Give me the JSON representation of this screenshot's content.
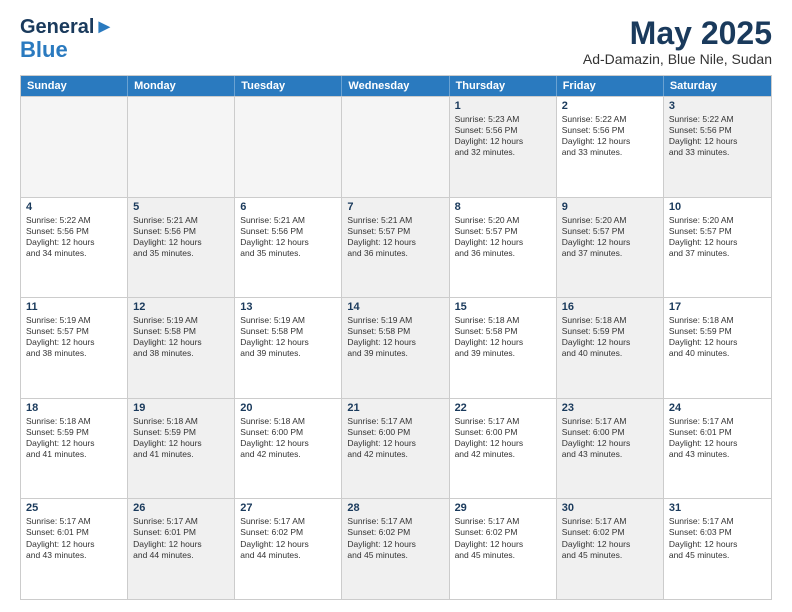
{
  "header": {
    "logo_line1": "General",
    "logo_line2": "Blue",
    "main_title": "May 2025",
    "subtitle": "Ad-Damazin, Blue Nile, Sudan"
  },
  "calendar": {
    "days_of_week": [
      "Sunday",
      "Monday",
      "Tuesday",
      "Wednesday",
      "Thursday",
      "Friday",
      "Saturday"
    ],
    "weeks": [
      [
        {
          "day": "",
          "empty": true
        },
        {
          "day": "",
          "empty": true
        },
        {
          "day": "",
          "empty": true
        },
        {
          "day": "",
          "empty": true
        },
        {
          "day": "1",
          "shaded": true,
          "lines": [
            "Sunrise: 5:23 AM",
            "Sunset: 5:56 PM",
            "Daylight: 12 hours",
            "and 32 minutes."
          ]
        },
        {
          "day": "2",
          "lines": [
            "Sunrise: 5:22 AM",
            "Sunset: 5:56 PM",
            "Daylight: 12 hours",
            "and 33 minutes."
          ]
        },
        {
          "day": "3",
          "shaded": true,
          "lines": [
            "Sunrise: 5:22 AM",
            "Sunset: 5:56 PM",
            "Daylight: 12 hours",
            "and 33 minutes."
          ]
        }
      ],
      [
        {
          "day": "4",
          "lines": [
            "Sunrise: 5:22 AM",
            "Sunset: 5:56 PM",
            "Daylight: 12 hours",
            "and 34 minutes."
          ]
        },
        {
          "day": "5",
          "shaded": true,
          "lines": [
            "Sunrise: 5:21 AM",
            "Sunset: 5:56 PM",
            "Daylight: 12 hours",
            "and 35 minutes."
          ]
        },
        {
          "day": "6",
          "lines": [
            "Sunrise: 5:21 AM",
            "Sunset: 5:56 PM",
            "Daylight: 12 hours",
            "and 35 minutes."
          ]
        },
        {
          "day": "7",
          "shaded": true,
          "lines": [
            "Sunrise: 5:21 AM",
            "Sunset: 5:57 PM",
            "Daylight: 12 hours",
            "and 36 minutes."
          ]
        },
        {
          "day": "8",
          "lines": [
            "Sunrise: 5:20 AM",
            "Sunset: 5:57 PM",
            "Daylight: 12 hours",
            "and 36 minutes."
          ]
        },
        {
          "day": "9",
          "shaded": true,
          "lines": [
            "Sunrise: 5:20 AM",
            "Sunset: 5:57 PM",
            "Daylight: 12 hours",
            "and 37 minutes."
          ]
        },
        {
          "day": "10",
          "lines": [
            "Sunrise: 5:20 AM",
            "Sunset: 5:57 PM",
            "Daylight: 12 hours",
            "and 37 minutes."
          ]
        }
      ],
      [
        {
          "day": "11",
          "lines": [
            "Sunrise: 5:19 AM",
            "Sunset: 5:57 PM",
            "Daylight: 12 hours",
            "and 38 minutes."
          ]
        },
        {
          "day": "12",
          "shaded": true,
          "lines": [
            "Sunrise: 5:19 AM",
            "Sunset: 5:58 PM",
            "Daylight: 12 hours",
            "and 38 minutes."
          ]
        },
        {
          "day": "13",
          "lines": [
            "Sunrise: 5:19 AM",
            "Sunset: 5:58 PM",
            "Daylight: 12 hours",
            "and 39 minutes."
          ]
        },
        {
          "day": "14",
          "shaded": true,
          "lines": [
            "Sunrise: 5:19 AM",
            "Sunset: 5:58 PM",
            "Daylight: 12 hours",
            "and 39 minutes."
          ]
        },
        {
          "day": "15",
          "lines": [
            "Sunrise: 5:18 AM",
            "Sunset: 5:58 PM",
            "Daylight: 12 hours",
            "and 39 minutes."
          ]
        },
        {
          "day": "16",
          "shaded": true,
          "lines": [
            "Sunrise: 5:18 AM",
            "Sunset: 5:59 PM",
            "Daylight: 12 hours",
            "and 40 minutes."
          ]
        },
        {
          "day": "17",
          "lines": [
            "Sunrise: 5:18 AM",
            "Sunset: 5:59 PM",
            "Daylight: 12 hours",
            "and 40 minutes."
          ]
        }
      ],
      [
        {
          "day": "18",
          "lines": [
            "Sunrise: 5:18 AM",
            "Sunset: 5:59 PM",
            "Daylight: 12 hours",
            "and 41 minutes."
          ]
        },
        {
          "day": "19",
          "shaded": true,
          "lines": [
            "Sunrise: 5:18 AM",
            "Sunset: 5:59 PM",
            "Daylight: 12 hours",
            "and 41 minutes."
          ]
        },
        {
          "day": "20",
          "lines": [
            "Sunrise: 5:18 AM",
            "Sunset: 6:00 PM",
            "Daylight: 12 hours",
            "and 42 minutes."
          ]
        },
        {
          "day": "21",
          "shaded": true,
          "lines": [
            "Sunrise: 5:17 AM",
            "Sunset: 6:00 PM",
            "Daylight: 12 hours",
            "and 42 minutes."
          ]
        },
        {
          "day": "22",
          "lines": [
            "Sunrise: 5:17 AM",
            "Sunset: 6:00 PM",
            "Daylight: 12 hours",
            "and 42 minutes."
          ]
        },
        {
          "day": "23",
          "shaded": true,
          "lines": [
            "Sunrise: 5:17 AM",
            "Sunset: 6:00 PM",
            "Daylight: 12 hours",
            "and 43 minutes."
          ]
        },
        {
          "day": "24",
          "lines": [
            "Sunrise: 5:17 AM",
            "Sunset: 6:01 PM",
            "Daylight: 12 hours",
            "and 43 minutes."
          ]
        }
      ],
      [
        {
          "day": "25",
          "lines": [
            "Sunrise: 5:17 AM",
            "Sunset: 6:01 PM",
            "Daylight: 12 hours",
            "and 43 minutes."
          ]
        },
        {
          "day": "26",
          "shaded": true,
          "lines": [
            "Sunrise: 5:17 AM",
            "Sunset: 6:01 PM",
            "Daylight: 12 hours",
            "and 44 minutes."
          ]
        },
        {
          "day": "27",
          "lines": [
            "Sunrise: 5:17 AM",
            "Sunset: 6:02 PM",
            "Daylight: 12 hours",
            "and 44 minutes."
          ]
        },
        {
          "day": "28",
          "shaded": true,
          "lines": [
            "Sunrise: 5:17 AM",
            "Sunset: 6:02 PM",
            "Daylight: 12 hours",
            "and 45 minutes."
          ]
        },
        {
          "day": "29",
          "lines": [
            "Sunrise: 5:17 AM",
            "Sunset: 6:02 PM",
            "Daylight: 12 hours",
            "and 45 minutes."
          ]
        },
        {
          "day": "30",
          "shaded": true,
          "lines": [
            "Sunrise: 5:17 AM",
            "Sunset: 6:02 PM",
            "Daylight: 12 hours",
            "and 45 minutes."
          ]
        },
        {
          "day": "31",
          "lines": [
            "Sunrise: 5:17 AM",
            "Sunset: 6:03 PM",
            "Daylight: 12 hours",
            "and 45 minutes."
          ]
        }
      ]
    ]
  }
}
